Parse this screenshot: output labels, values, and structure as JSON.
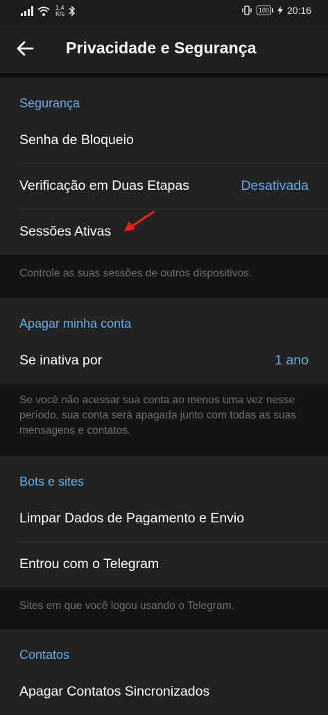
{
  "status_bar": {
    "speed_value": "1,4",
    "speed_unit": "K/s",
    "battery": "100",
    "time": "20:16"
  },
  "app_bar": {
    "title": "Privacidade e Segurança"
  },
  "sections": {
    "security": {
      "header": "Segurança",
      "items": {
        "passcode": {
          "label": "Senha de Bloqueio"
        },
        "two_step": {
          "label": "Verificação em Duas Etapas",
          "value": "Desativada"
        },
        "sessions": {
          "label": "Sessões Ativas"
        }
      },
      "hint": "Controle as suas sessões de outros dispositivos."
    },
    "delete_account": {
      "header": "Apagar minha conta",
      "items": {
        "if_away": {
          "label": "Se inativa por",
          "value": "1 ano"
        }
      },
      "hint": "Se você não acessar sua conta ao menos uma vez nesse período, sua conta será apagada junto com todas as suas mensagens e contatos."
    },
    "bots": {
      "header": "Bots e sites",
      "items": {
        "clear_payment": {
          "label": "Limpar Dados de Pagamento e Envio"
        },
        "logged_in": {
          "label": "Entrou com o Telegram"
        }
      },
      "hint": "Sites em que você logou usando o Telegram."
    },
    "contacts": {
      "header": "Contatos",
      "items": {
        "delete_synced": {
          "label": "Apagar Contatos Sincronizados"
        }
      }
    }
  },
  "colors": {
    "accent": "#64abe8",
    "annotation_arrow": "#e8221b"
  }
}
